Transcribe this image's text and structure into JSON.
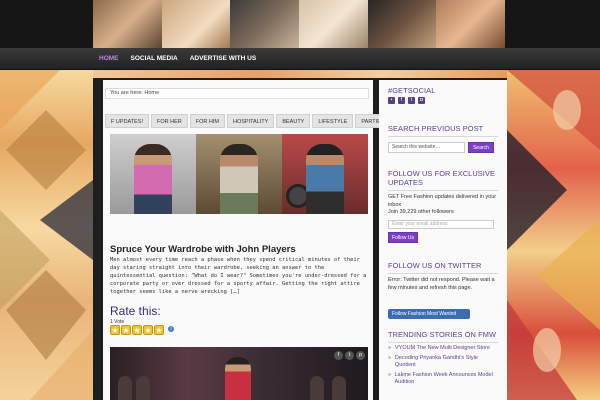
{
  "nav": {
    "items": [
      "HOME",
      "SOCIAL MEDIA",
      "ADVERTISE WITH US"
    ],
    "active_index": 0
  },
  "breadcrumb": {
    "text": "You are here: Home"
  },
  "tabs": [
    "F UPDATES!",
    "FOR HER",
    "FOR HIM",
    "HOSPITALITY",
    "BEAUTY",
    "LIFESTYLE",
    "PARTIES"
  ],
  "post": {
    "title": "Spruce Your Wardrobe with John Players",
    "excerpt": "Men almost every time reach a phase when they spend critical minutes of their day staring straight into their wardrobe, seeking an answer to the quintessential question: \"What do I wear?\" Sometimes you're under-dressed for a corporate party or over dressed for a sporty affair. Getting the right attire together seems like a nerve wrecking […]",
    "rate_title": "Rate this:",
    "votes": "1 Vote",
    "rating_stars": 5
  },
  "sidebar": {
    "getsocial": {
      "title": "#GETSOCIAL",
      "icons": [
        "rss-icon",
        "facebook-icon",
        "twitter-icon",
        "instagram-icon"
      ]
    },
    "search": {
      "title": "SEARCH PREVIOUS POST",
      "placeholder": "Search this website…",
      "button": "Search"
    },
    "follow": {
      "title": "FOLLOW US FOR EXCLUSIVE UPDATES",
      "text": "GET Free Fashion updates delivered in your inbox",
      "followers": "Join 39,229 other followers",
      "email_placeholder": "Enter your email address",
      "button": "Follow Us"
    },
    "twitter": {
      "title": "FOLLOW US ON TWITTER",
      "text": "Error: Twitter did not respond. Please wait a few minutes and refresh this page."
    },
    "fb_follow": "Follow Fashion Most Wanted",
    "trending": {
      "title": "TRENDING STORIES ON FMW",
      "items": [
        "VYOUM The New Multi Designer Store",
        "Decoding Priyanka Gandhi's Style Quotient",
        "Lakme Fashion Week Announces Model Audition"
      ]
    }
  },
  "colors": {
    "accent": "#7b3fc4",
    "heading": "#5a3f8a",
    "nav_active": "#c08ae0"
  }
}
